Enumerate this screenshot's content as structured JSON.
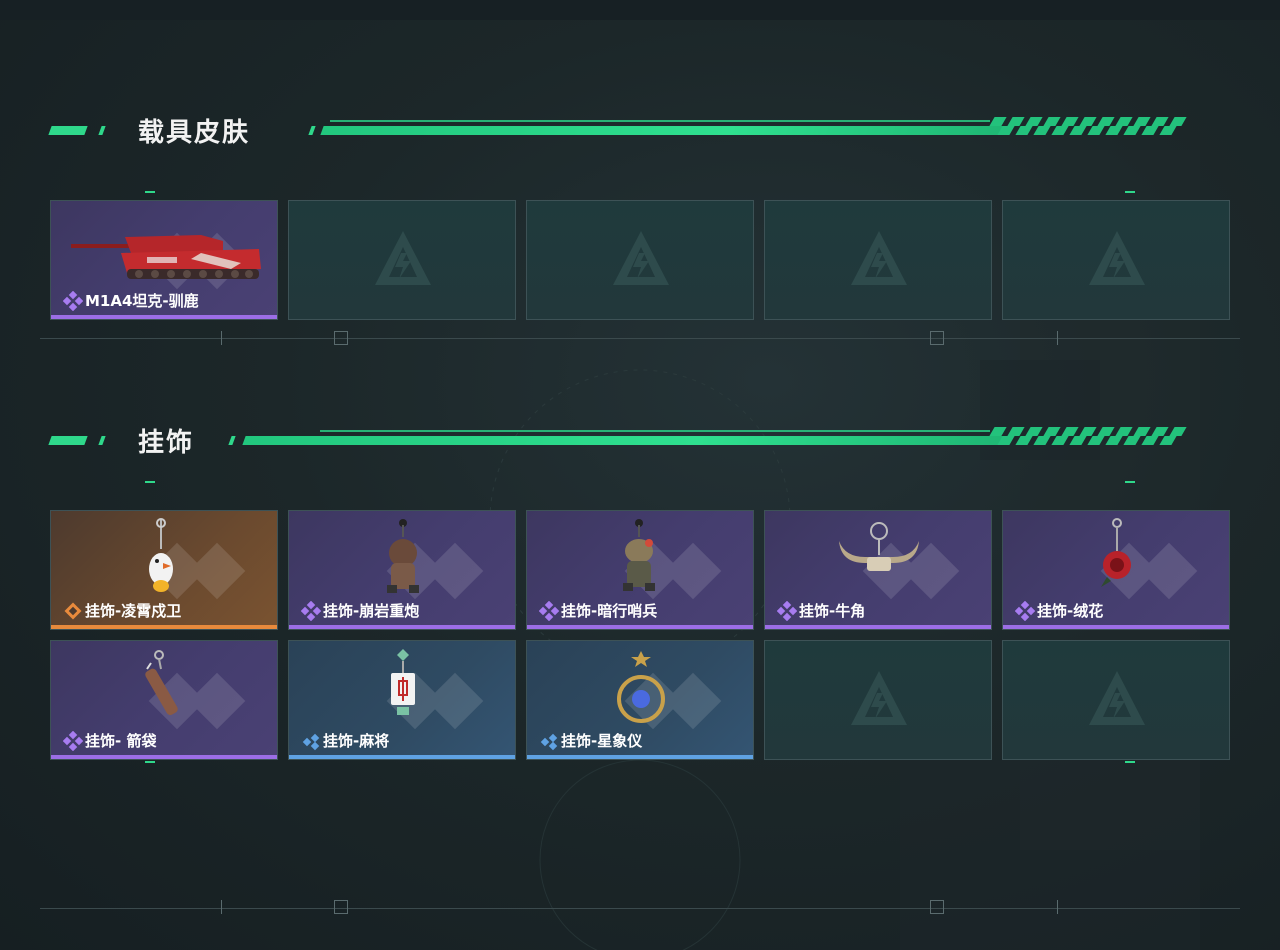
{
  "sections": [
    {
      "title": "载具皮肤",
      "items": [
        {
          "label": "M1A4坦克-驯鹿",
          "rarity": "purple",
          "icon": "tank-icon"
        },
        {
          "label": "",
          "rarity": "empty"
        },
        {
          "label": "",
          "rarity": "empty"
        },
        {
          "label": "",
          "rarity": "empty"
        },
        {
          "label": "",
          "rarity": "empty"
        }
      ]
    },
    {
      "title": "挂饰",
      "items": [
        {
          "label": "挂饰-凌霄戍卫",
          "rarity": "orange",
          "icon": "chick-charm-icon"
        },
        {
          "label": "挂饰-崩岩重炮",
          "rarity": "purple",
          "icon": "soldier-charm-icon"
        },
        {
          "label": "挂饰-暗行哨兵",
          "rarity": "purple",
          "icon": "sentry-charm-icon"
        },
        {
          "label": "挂饰-牛角",
          "rarity": "purple",
          "icon": "horn-charm-icon"
        },
        {
          "label": "挂饰-绒花",
          "rarity": "purple",
          "icon": "rose-charm-icon"
        },
        {
          "label": "挂饰- 箭袋",
          "rarity": "purple",
          "icon": "quiver-charm-icon"
        },
        {
          "label": "挂饰-麻将",
          "rarity": "blue",
          "icon": "mahjong-charm-icon"
        },
        {
          "label": "挂饰-星象仪",
          "rarity": "blue",
          "icon": "astrolabe-charm-icon"
        },
        {
          "label": "",
          "rarity": "empty"
        },
        {
          "label": "",
          "rarity": "empty"
        }
      ]
    }
  ],
  "colors": {
    "accent": "#2fd88b",
    "purple": "#9c6ee6",
    "orange": "#e88a3c",
    "blue": "#5fa2e3"
  }
}
